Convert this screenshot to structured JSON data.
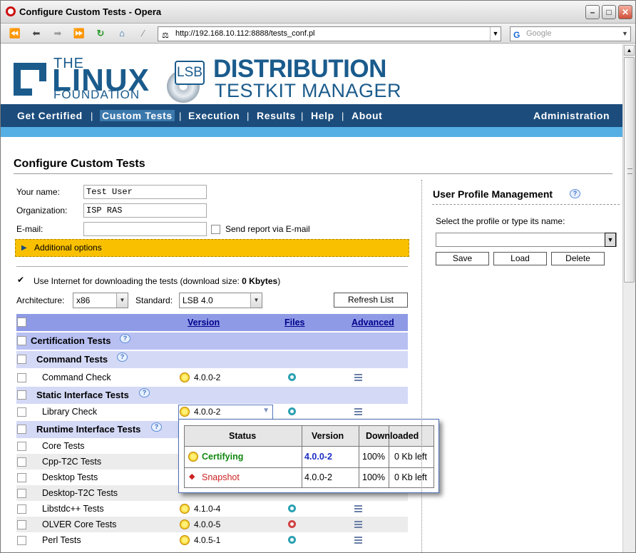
{
  "window": {
    "title": "Configure Custom Tests - Opera"
  },
  "browser": {
    "url": "http://192.168.10.112:8888/tests_conf.pl",
    "search_placeholder": "Google",
    "search_engine_icon": "google-icon"
  },
  "logo": {
    "the": "THE",
    "linux": "LINUX",
    "foundation": "FOUNDATION",
    "lsb": "LSB",
    "line1": "DISTRIBUTION",
    "line2": "TESTKIT MANAGER"
  },
  "nav": {
    "items": [
      "Get Certified",
      "Custom Tests",
      "Execution",
      "Results",
      "Help",
      "About"
    ],
    "admin": "Administration",
    "active": "Custom Tests"
  },
  "page": {
    "title": "Configure Custom Tests"
  },
  "form": {
    "name_label": "Your name:",
    "name_value": "Test User",
    "org_label": "Organization:",
    "org_value": "ISP RAS",
    "email_label": "E-mail:",
    "email_value": "",
    "send_report_label": "Send report via E-mail",
    "send_report_checked": false,
    "additional_options": "Additional options",
    "use_internet_label": "Use Internet for downloading the tests (download size: ",
    "download_size": "0 Kbytes",
    "use_internet_suffix": ")",
    "use_internet_checked": true,
    "arch_label": "Architecture:",
    "arch_value": "x86",
    "std_label": "Standard:",
    "std_value": "LSB 4.0",
    "refresh_button": "Refresh List"
  },
  "table": {
    "headers": {
      "version": "Version",
      "files": "Files",
      "advanced": "Advanced"
    },
    "groups": {
      "certification": "Certification Tests",
      "command": "Command Tests",
      "static": "Static Interface Tests",
      "runtime": "Runtime Interface Tests"
    },
    "rows": {
      "command_check": {
        "name": "Command Check",
        "version": "4.0.0-2"
      },
      "library_check": {
        "name": "Library Check",
        "version": "4.0.0-2"
      },
      "core": {
        "name": "Core Tests"
      },
      "cpp": {
        "name": "Cpp-T2C Tests"
      },
      "desktop": {
        "name": "Desktop Tests"
      },
      "desktop_t2c": {
        "name": "Desktop-T2C Tests"
      },
      "libstdcpp": {
        "name": "Libstdc++ Tests",
        "version": "4.1.0-4"
      },
      "olver": {
        "name": "OLVER Core Tests",
        "version": "4.0.0-5"
      },
      "perl": {
        "name": "Perl Tests",
        "version": "4.0.5-1"
      }
    }
  },
  "version_popup": {
    "headers": {
      "status": "Status",
      "version": "Version",
      "downloaded": "Downloaded"
    },
    "rows": [
      {
        "status": "Certifying",
        "version": "4.0.0-2",
        "percent": "100%",
        "left": "0 Kb left",
        "status_color": "#118811"
      },
      {
        "status": "Snapshot",
        "version": "4.0.0-2",
        "percent": "100%",
        "left": "0 Kb left",
        "status_color": "#cc2222"
      }
    ]
  },
  "profile": {
    "title": "User Profile Management",
    "select_label": "Select the profile or type its name:",
    "value": "",
    "save": "Save",
    "load": "Load",
    "delete": "Delete"
  },
  "colors": {
    "nav_bg": "#1b4c7c",
    "accent_bar": "#55aee4",
    "options_bar": "#f9c000",
    "table_header": "#8f9ae6"
  }
}
